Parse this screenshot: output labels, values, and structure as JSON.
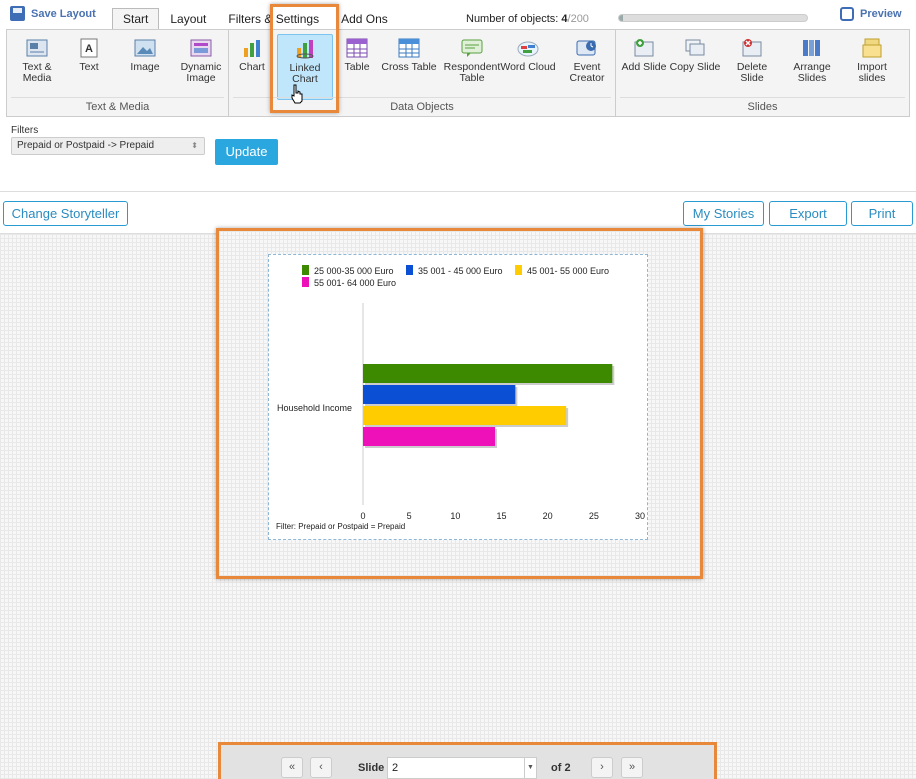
{
  "toolbar": {
    "save_label": "Save Layout",
    "tabs": [
      {
        "label": "Start",
        "active": true
      },
      {
        "label": "Layout"
      },
      {
        "label": "Filters & Settings"
      },
      {
        "label": "Add Ons"
      }
    ],
    "objects_label": "Number of objects:",
    "objects_count": "4",
    "objects_total": "/200",
    "objects_progress": 0.02,
    "preview_label": "Preview"
  },
  "ribbon": {
    "groups": [
      {
        "label": "Text & Media",
        "items": [
          "Text & Media",
          "Text",
          "Image",
          "Dynamic Image"
        ]
      },
      {
        "label": "Data Objects",
        "items": [
          "Chart",
          "Linked Chart",
          "Table",
          "Cross Table",
          "Respondent Table",
          "Word Cloud",
          "Event Creator"
        ]
      },
      {
        "label": "Slides",
        "items": [
          "Add Slide",
          "Copy Slide",
          "Delete Slide",
          "Arrange Slides",
          "Import slides"
        ]
      }
    ],
    "selected": "Linked Chart",
    "colors": {
      "accent": "#e8883a",
      "selected_bg": "#bfe6fb"
    }
  },
  "filters": {
    "label": "Filters",
    "selected_value": "Prepaid or Postpaid -> Prepaid",
    "update_label": "Update"
  },
  "actions": {
    "change_storyteller": "Change Storyteller",
    "my_stories": "My Stories",
    "export": "Export",
    "print": "Print"
  },
  "chart_data": {
    "type": "bar",
    "orientation": "horizontal",
    "categories": [
      "Household Income"
    ],
    "series": [
      {
        "name": "25 000-35 000 Euro",
        "values": [
          27
        ],
        "color": "#3d8a00"
      },
      {
        "name": "35 001 - 45 000 Euro",
        "values": [
          16.5
        ],
        "color": "#0a4fd4"
      },
      {
        "name": "45 001- 55 000 Euro",
        "values": [
          22
        ],
        "color": "#ffcc00"
      },
      {
        "name": "55 001- 64 000 Euro",
        "values": [
          14.3
        ],
        "color": "#ee10b8"
      }
    ],
    "xlim": [
      0,
      30
    ],
    "xticks": [
      "0",
      "5",
      "10",
      "15",
      "20",
      "25",
      "30"
    ],
    "legend_position": "top",
    "footnote": "Filter: Prepaid or Postpaid = Prepaid"
  },
  "pager": {
    "slide_label": "Slide",
    "current": "2",
    "of_label": "of 2",
    "first": "«",
    "prev": "‹",
    "next": "›",
    "last": "»"
  }
}
